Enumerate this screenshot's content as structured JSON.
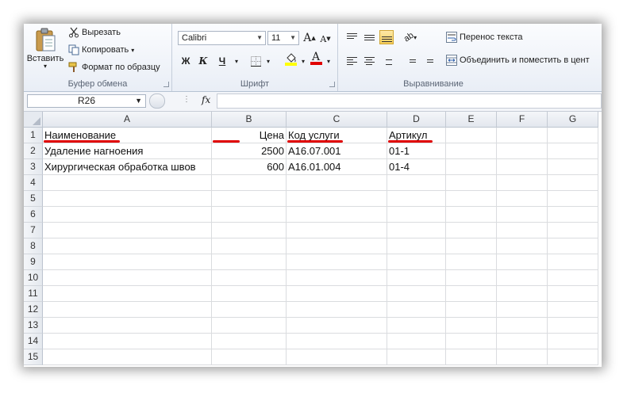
{
  "ribbon": {
    "clipboard": {
      "paste_label": "Вставить",
      "cut_label": "Вырезать",
      "copy_label": "Копировать",
      "format_painter_label": "Формат по образцу",
      "group_label": "Буфер обмена"
    },
    "font": {
      "font_name": "Calibri",
      "font_size": "11",
      "bold": "Ж",
      "italic": "К",
      "underline": "Ч",
      "grow": "A",
      "shrink": "A",
      "font_color_glyph": "A",
      "group_label": "Шрифт"
    },
    "alignment": {
      "wrap_text_label": "Перенос текста",
      "merge_label": "Объединить и поместить в цент",
      "group_label": "Выравнивание"
    }
  },
  "formula_bar": {
    "name_box": "R26",
    "fx": "fx",
    "content": ""
  },
  "sheet": {
    "columns": [
      "A",
      "B",
      "C",
      "D",
      "E",
      "F",
      "G"
    ],
    "rows": [
      "1",
      "2",
      "3",
      "4",
      "5",
      "6",
      "7",
      "8",
      "9",
      "10",
      "11",
      "12",
      "13",
      "14",
      "15"
    ],
    "cells": {
      "A1": "Наименование",
      "B1": "Цена",
      "C1": "Код услуги",
      "D1": "Артикул",
      "A2": "Удаление нагноения",
      "B2": "2500",
      "C2": "A16.07.001",
      "D2": "01-1",
      "A3": "Хирургическая обработка швов",
      "B3": "600",
      "C3": "A16.01.004",
      "D3": "01-4"
    },
    "underline_color": "#e00000"
  }
}
